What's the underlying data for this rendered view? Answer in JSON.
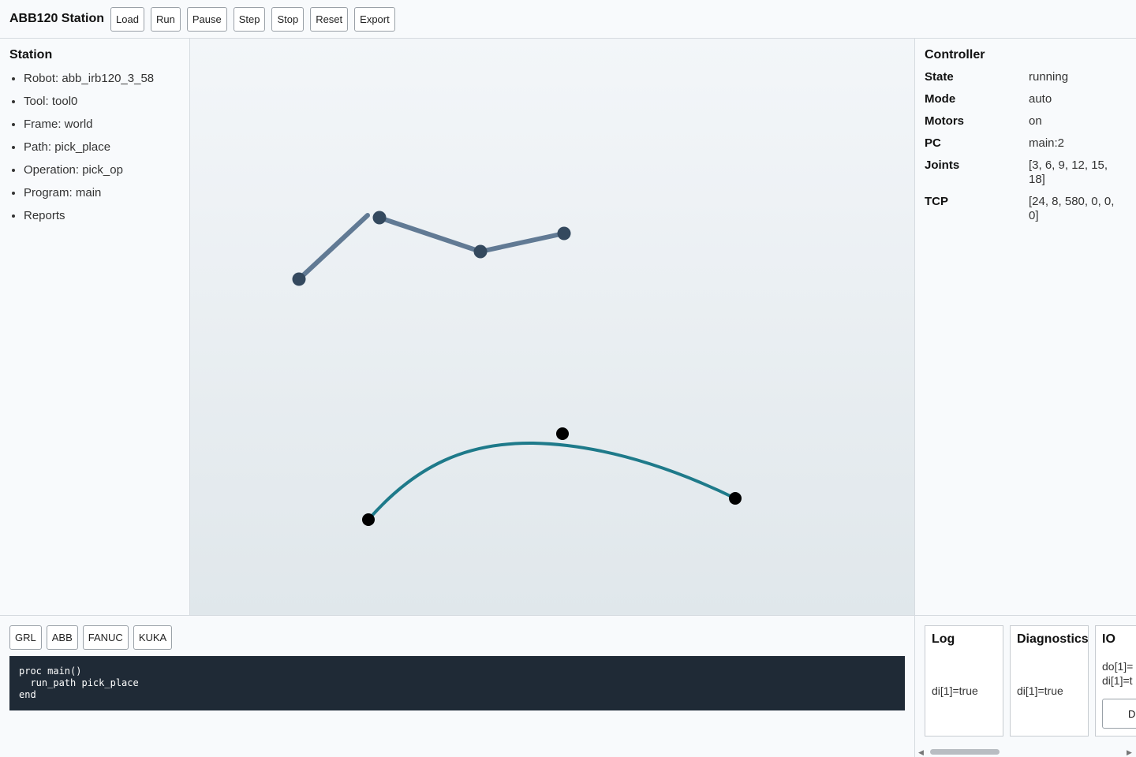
{
  "header": {
    "title": "ABB120 Station",
    "buttons": [
      "Load",
      "Run",
      "Pause",
      "Step",
      "Stop",
      "Reset",
      "Export"
    ]
  },
  "station": {
    "title": "Station",
    "items": [
      "Robot: abb_irb120_3_58",
      "Tool: tool0",
      "Frame: world",
      "Path: pick_place",
      "Operation: pick_op",
      "Program: main",
      "Reports"
    ]
  },
  "controller": {
    "title": "Controller",
    "rows": [
      {
        "key": "State",
        "value": "running"
      },
      {
        "key": "Mode",
        "value": "auto"
      },
      {
        "key": "Motors",
        "value": "on"
      },
      {
        "key": "PC",
        "value": "main:2"
      },
      {
        "key": "Joints",
        "value": "[3, 6, 9, 12, 15, 18]"
      },
      {
        "key": "TCP",
        "value": "[24, 8, 580, 0, 0, 0]"
      }
    ]
  },
  "code_tabs": [
    "GRL",
    "ABB",
    "FANUC",
    "KUKA"
  ],
  "code": "proc main()\n  run_path pick_place\nend",
  "panels": {
    "log": {
      "title": "Log",
      "body": "di[1]=true"
    },
    "diagnostics": {
      "title": "Diagnostics",
      "body": "di[1]=true"
    },
    "io": {
      "title": "IO",
      "lines": [
        "do[1]=",
        "di[1]=t"
      ],
      "button": "Di"
    }
  },
  "colors": {
    "robot_arm": "#617a94",
    "robot_joint": "#34495e",
    "path_curve": "#1e7a8a",
    "path_point": "#000000",
    "code_bg": "#1f2a36"
  }
}
